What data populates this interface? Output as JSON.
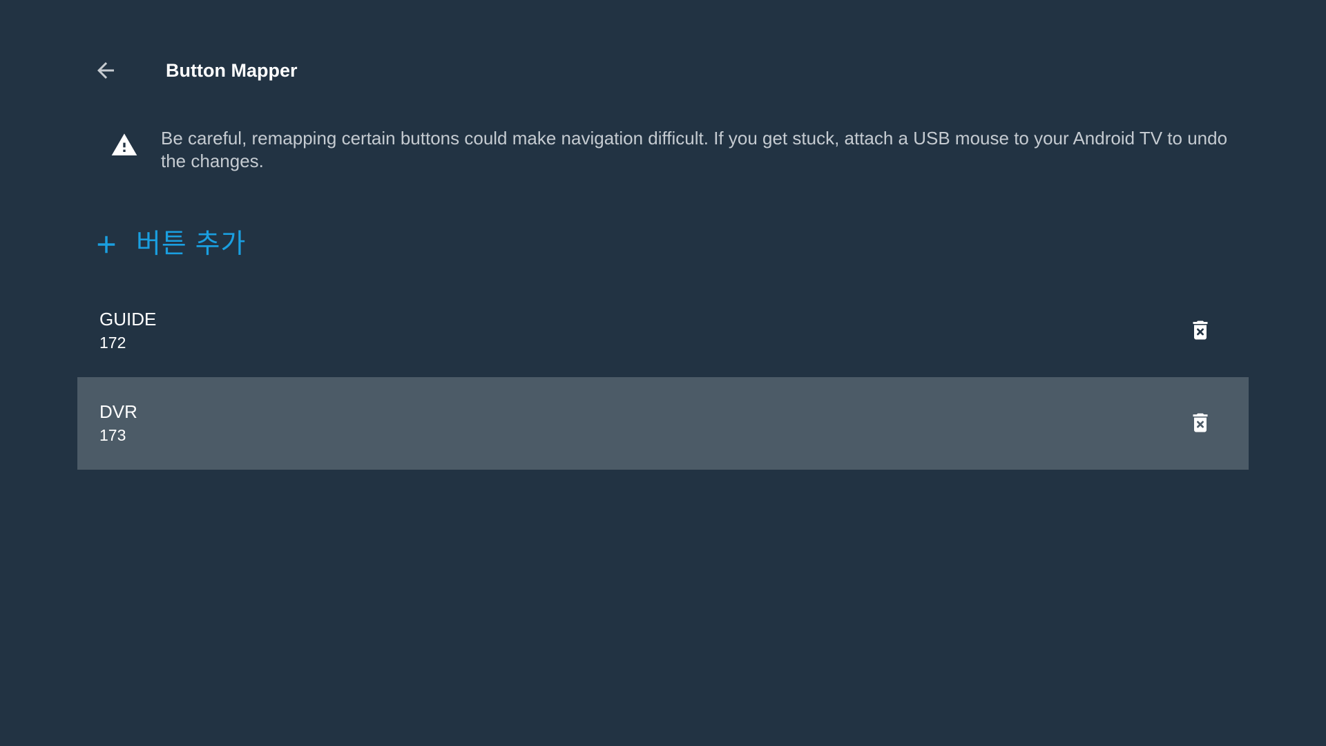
{
  "header": {
    "title": "Button Mapper",
    "back_icon": "arrow-back-icon"
  },
  "warning": {
    "icon": "warning-triangle-icon",
    "text": "Be careful, remapping certain buttons could make navigation difficult. If you get stuck, attach a USB mouse to your Android TV to undo the changes."
  },
  "add_button": {
    "icon": "plus-icon",
    "label": "버튼 추가"
  },
  "mappings": [
    {
      "name": "GUIDE",
      "code": "172",
      "selected": false,
      "delete_icon": "trash-icon"
    },
    {
      "name": "DVR",
      "code": "173",
      "selected": true,
      "delete_icon": "trash-icon"
    }
  ],
  "colors": {
    "background": "#223343",
    "accent": "#1a9fe0",
    "selected_row": "#4c5b67",
    "warning_text": "#c5cbd1"
  }
}
